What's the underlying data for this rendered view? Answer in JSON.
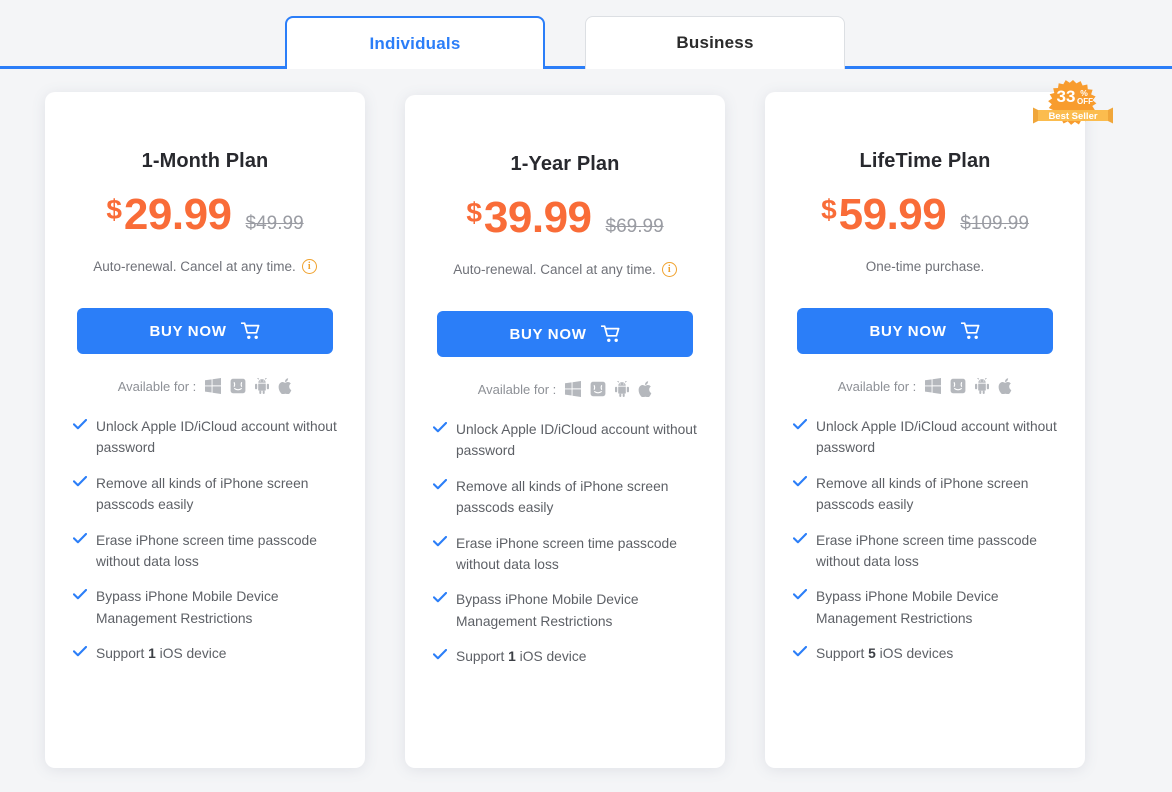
{
  "tabs": [
    {
      "id": "individuals",
      "label": "Individuals",
      "active": true
    },
    {
      "id": "business",
      "label": "Business",
      "active": false
    }
  ],
  "badge": {
    "percent": "33",
    "percent_symbol": "%",
    "off_label": "OFF",
    "ribbon_label": "Best Seller",
    "color": "#f89c2e",
    "ribbon_color": "#fbbc4e"
  },
  "colors": {
    "accent_blue": "#2b7ef8",
    "price_orange": "#f96c38",
    "page_bg": "#f4f5f7",
    "card_bg": "#ffffff",
    "muted_text": "#6f7178",
    "info_orange": "#f0a22e"
  },
  "common": {
    "currency": "$",
    "buy_label": "BUY NOW",
    "available_label": "Available for :",
    "info_glyph": "i",
    "platforms": [
      "windows-icon",
      "mac-finder-icon",
      "android-icon",
      "apple-icon"
    ]
  },
  "plans": [
    {
      "title": "1-Month Plan",
      "price": "29.99",
      "old_price": "$49.99",
      "note": "Auto-renewal. Cancel at any time.",
      "has_info_icon": true,
      "features": [
        {
          "pre": "Unlock Apple ID/iCloud account without password",
          "strong": "",
          "post": ""
        },
        {
          "pre": "Remove all kinds of iPhone screen passcods easily",
          "strong": "",
          "post": ""
        },
        {
          "pre": "Erase iPhone screen time passcode without data loss",
          "strong": "",
          "post": ""
        },
        {
          "pre": "Bypass iPhone Mobile Device Management Restrictions",
          "strong": "",
          "post": ""
        },
        {
          "pre": "Support ",
          "strong": "1",
          "post": " iOS device"
        }
      ]
    },
    {
      "title": "1-Year Plan",
      "price": "39.99",
      "old_price": "$69.99",
      "note": "Auto-renewal. Cancel at any time.",
      "has_info_icon": true,
      "features": [
        {
          "pre": "Unlock Apple ID/iCloud account without password",
          "strong": "",
          "post": ""
        },
        {
          "pre": "Remove all kinds of iPhone screen passcods easily",
          "strong": "",
          "post": ""
        },
        {
          "pre": "Erase iPhone screen time passcode without data loss",
          "strong": "",
          "post": ""
        },
        {
          "pre": "Bypass iPhone Mobile Device Management Restrictions",
          "strong": "",
          "post": ""
        },
        {
          "pre": "Support ",
          "strong": "1",
          "post": " iOS device"
        }
      ]
    },
    {
      "title": "LifeTime Plan",
      "price": "59.99",
      "old_price": "$109.99",
      "note": "One-time purchase.",
      "has_info_icon": false,
      "features": [
        {
          "pre": "Unlock Apple ID/iCloud account without password",
          "strong": "",
          "post": ""
        },
        {
          "pre": "Remove all kinds of iPhone screen passcods easily",
          "strong": "",
          "post": ""
        },
        {
          "pre": "Erase iPhone screen time passcode without data loss",
          "strong": "",
          "post": ""
        },
        {
          "pre": "Bypass iPhone Mobile Device Management Restrictions",
          "strong": "",
          "post": ""
        },
        {
          "pre": "Support ",
          "strong": "5",
          "post": " iOS devices"
        }
      ]
    }
  ]
}
